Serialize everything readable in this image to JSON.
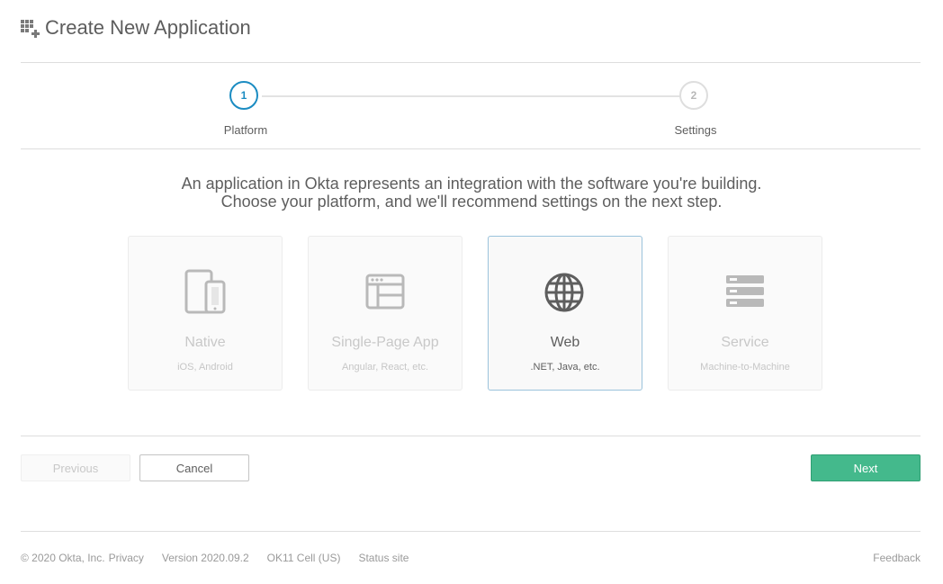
{
  "header": {
    "title": "Create New Application",
    "icon": "add-app-grid-icon"
  },
  "stepper": {
    "steps": [
      {
        "number": "1",
        "label": "Platform",
        "state": "active"
      },
      {
        "number": "2",
        "label": "Settings",
        "state": "inactive"
      }
    ],
    "colors": {
      "active": "#1b8cc2",
      "inactive": "#dedede"
    }
  },
  "intro": {
    "line1": "An application in Okta represents an integration with the software you're building.",
    "line2": "Choose your platform, and we'll recommend settings on the next step."
  },
  "platforms": [
    {
      "title": "Native",
      "subtitle": "iOS, Android",
      "icon": "devices-icon",
      "selected": false
    },
    {
      "title": "Single-Page App",
      "subtitle": "Angular, React, etc.",
      "icon": "browser-window-icon",
      "selected": false
    },
    {
      "title": "Web",
      "subtitle": ".NET, Java, etc.",
      "icon": "globe-icon",
      "selected": true
    },
    {
      "title": "Service",
      "subtitle": "Machine-to-Machine",
      "icon": "server-stack-icon",
      "selected": false
    }
  ],
  "buttons": {
    "previous": "Previous",
    "cancel": "Cancel",
    "next": "Next",
    "next_color": "#44b98c"
  },
  "footer": {
    "copyright": "© 2020 Okta, Inc.",
    "privacy": "Privacy",
    "version": "Version 2020.09.2",
    "cell": "OK11 Cell (US)",
    "status": "Status site",
    "feedback": "Feedback"
  }
}
